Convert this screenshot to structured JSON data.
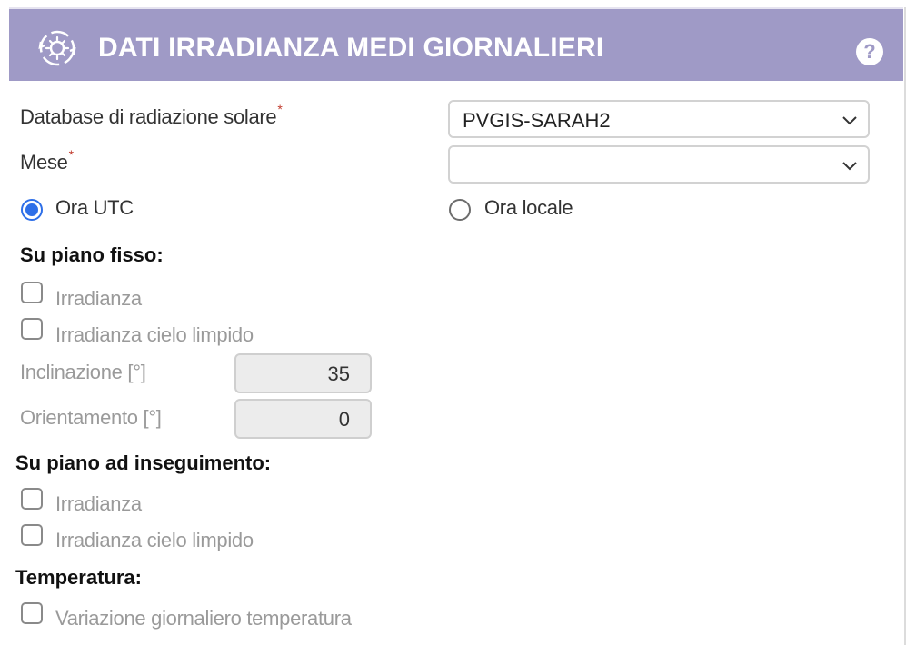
{
  "header": {
    "title": "DATI IRRADIANZA MEDI GIORNALIERI",
    "icon": "sun-settings-icon",
    "help_label": "?"
  },
  "form": {
    "database": {
      "label": "Database di radiazione solare",
      "required_mark": "*",
      "selected": "PVGIS-SARAH2"
    },
    "month": {
      "label": "Mese",
      "required_mark": "*",
      "selected": ""
    },
    "time_mode": {
      "utc_label": "Ora UTC",
      "local_label": "Ora locale",
      "selected": "utc"
    },
    "fixed_plane": {
      "title": "Su piano fisso:",
      "irradiance_label": "Irradianza",
      "clear_sky_label": "Irradianza cielo limpido",
      "inclination_label": "Inclinazione [°]",
      "inclination_value": "35",
      "orientation_label": "Orientamento [°]",
      "orientation_value": "0"
    },
    "tracking_plane": {
      "title": "Su piano ad inseguimento:",
      "irradiance_label": "Irradianza",
      "clear_sky_label": "Irradianza cielo limpido"
    },
    "temperature": {
      "title": "Temperatura:",
      "daily_variation_label": "Variazione giornaliero temperatura"
    }
  },
  "colors": {
    "header_bg": "#9f9ac6",
    "radio_accent": "#2e6fe8",
    "required_mark": "#c0392b"
  }
}
